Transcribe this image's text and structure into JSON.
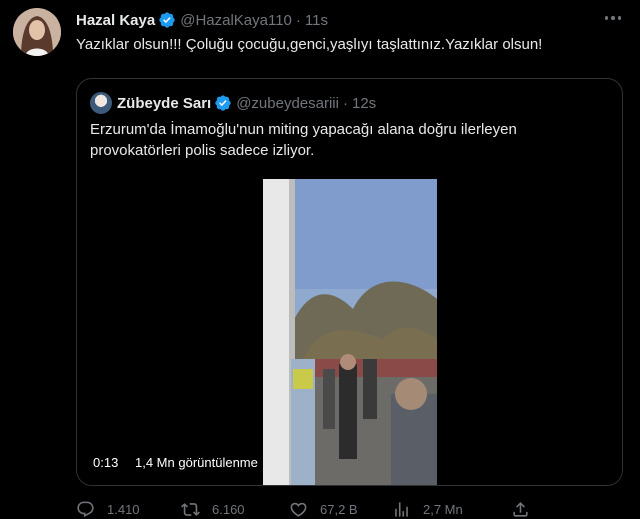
{
  "author": {
    "name": "Hazal Kaya",
    "handle": "@HazalKaya110",
    "separator": "·",
    "time": "11s",
    "verified": true,
    "verified_color": "#1d9bf0"
  },
  "tweet_text": "Yazıklar olsun!!! Çoluğu çocuğu,genci,yaşlıyı taşlattınız.Yazıklar olsun!",
  "quoted": {
    "name": "Zübeyde Sarı",
    "handle": "@zubeydesariii",
    "separator": "·",
    "time": "12s",
    "verified": true,
    "text": "Erzurum'da İmamoğlu'nun miting yapacağı alana doğru ilerleyen provokatörleri polis sadece izliyor.",
    "video": {
      "duration": "0:13",
      "views": "1,4 Mn görüntülenme"
    }
  },
  "actions": {
    "replies": "1.410",
    "retweets": "6.160",
    "likes": "67,2 B",
    "views": "2,7 Mn"
  },
  "icons": [
    "more-icon",
    "verified-icon",
    "reply-icon",
    "retweet-icon",
    "like-icon",
    "views-icon",
    "share-icon"
  ]
}
